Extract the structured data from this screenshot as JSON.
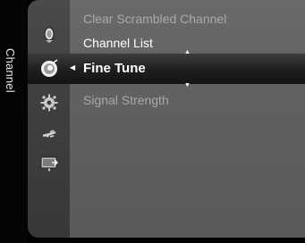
{
  "sidebar": {
    "label": "Channel"
  },
  "icons": [
    "satellite-dish-icon",
    "tv-antenna-icon",
    "gear-icon",
    "plug-icon",
    "picture-input-icon"
  ],
  "menu": {
    "items": [
      {
        "label": "Clear Scrambled Channel",
        "state": "disabled"
      },
      {
        "label": "Channel List",
        "state": "normal"
      },
      {
        "label": "Fine Tune",
        "state": "selected"
      },
      {
        "label": "Signal Strength",
        "state": "disabled"
      }
    ]
  },
  "colors": {
    "panel": "#606060",
    "rail": "#404040",
    "highlight": "#1e1e1e",
    "text": "#ffffff",
    "text_disabled": "#a9a9a9"
  }
}
